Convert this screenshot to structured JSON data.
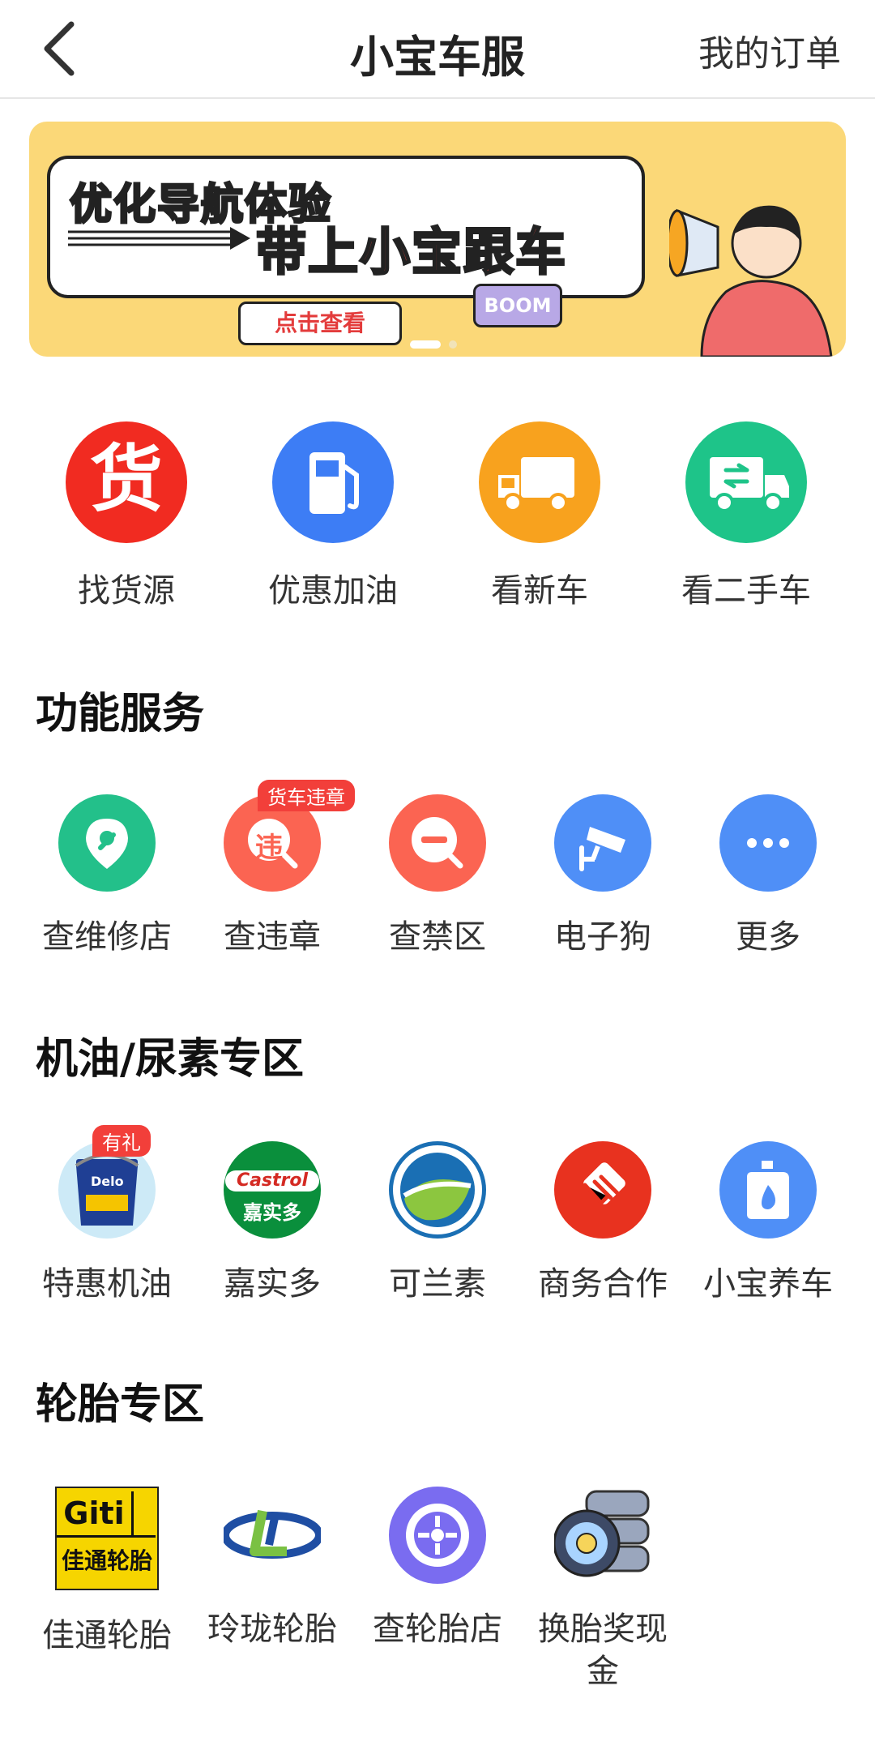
{
  "nav": {
    "title": "小宝车服",
    "orders": "我的订单"
  },
  "banner": {
    "headline": "优化导航体验",
    "slogan": "带上小宝跟车",
    "button": "点击查看",
    "bubble": "BOOM",
    "colors": {
      "bg": "#fbd878",
      "slogan": "#f0423c"
    }
  },
  "main_icons": [
    {
      "label": "找货源",
      "icon": "huo-icon",
      "glyph": "货",
      "color": "#f12b21"
    },
    {
      "label": "优惠加油",
      "icon": "fuel-pump-icon",
      "color": "#3d7df5"
    },
    {
      "label": "看新车",
      "icon": "truck-icon",
      "color": "#f8a21e"
    },
    {
      "label": "看二手车",
      "icon": "used-truck-icon",
      "color": "#1ec489"
    }
  ],
  "sections": {
    "functions": {
      "title": "功能服务",
      "items": [
        {
          "label": "查维修店",
          "icon": "wrench-icon",
          "color": "#23c08a"
        },
        {
          "label": "查违章",
          "icon": "violation-search-icon",
          "glyph": "违",
          "color": "#fb6452",
          "tag": "货车违章"
        },
        {
          "label": "查禁区",
          "icon": "no-entry-icon",
          "color": "#fb6452"
        },
        {
          "label": "电子狗",
          "icon": "camera-icon",
          "color": "#4f8ff7"
        },
        {
          "label": "更多",
          "icon": "more-icon",
          "color": "#4f8ff7"
        }
      ]
    },
    "oil": {
      "title": "机油/尿素专区",
      "items": [
        {
          "label": "特惠机油",
          "icon": "oil-bucket-icon",
          "tag": "有礼",
          "brand": "Delo"
        },
        {
          "label": "嘉实多",
          "icon": "castrol-logo-icon",
          "brand": "Castrol",
          "brand_cn": "嘉实多",
          "color": "#0a8f3c"
        },
        {
          "label": "可兰素",
          "icon": "kelansu-logo-icon",
          "color": "#1a6fb4"
        },
        {
          "label": "商务合作",
          "icon": "handshake-icon",
          "color": "#e8321f"
        },
        {
          "label": "小宝养车",
          "icon": "oil-bottle-icon",
          "color": "#4f8ff7"
        }
      ]
    },
    "tires": {
      "title": "轮胎专区",
      "items": [
        {
          "label": "佳通轮胎",
          "icon": "giti-logo-icon",
          "brand": "Giti",
          "brand_cn": "佳通轮胎",
          "color": "#f6d500"
        },
        {
          "label": "玲珑轮胎",
          "icon": "linglong-logo-icon",
          "color": "#1f4ea3"
        },
        {
          "label": "查轮胎店",
          "icon": "tire-icon",
          "color": "#7a6cf0"
        },
        {
          "label": "换胎奖现金",
          "icon": "tire-stack-icon"
        }
      ]
    }
  }
}
